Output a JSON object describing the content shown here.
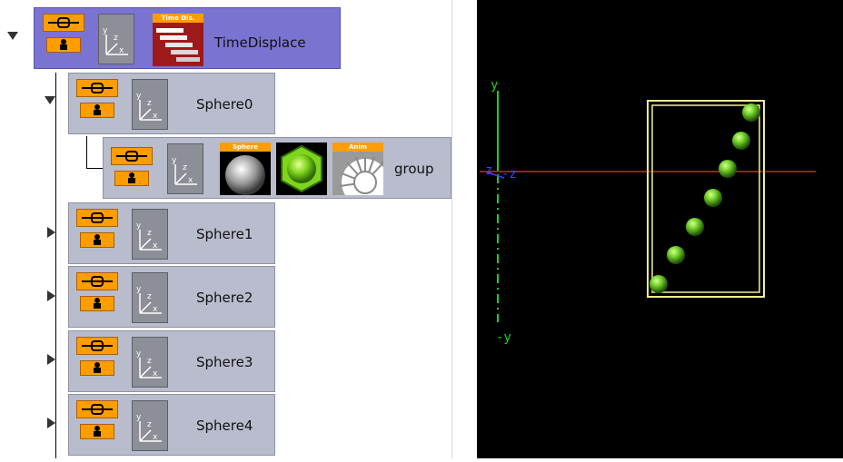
{
  "tree": {
    "root": {
      "label": "TimeDisplace",
      "plugin_tag": "Time Dis."
    },
    "sphere0": {
      "label": "Sphere0"
    },
    "group": {
      "label": "group",
      "sphere_tag": "Sphere",
      "anim_tag": "Anim"
    },
    "children": [
      {
        "label": "Sphere1"
      },
      {
        "label": "Sphere2"
      },
      {
        "label": "Sphere3"
      },
      {
        "label": "Sphere4"
      }
    ]
  },
  "viewport": {
    "axis_labels": {
      "y": "y",
      "neg_y": "-y",
      "z": "z",
      "neg_z": "-z"
    },
    "colors": {
      "background": "#000000",
      "x_axis": "#e02020",
      "y_axis": "#20d020",
      "z_axis": "#4040ff",
      "bbox": "#f2f08c",
      "sphere": "#6fcf2a"
    },
    "sphere_count": 7
  }
}
